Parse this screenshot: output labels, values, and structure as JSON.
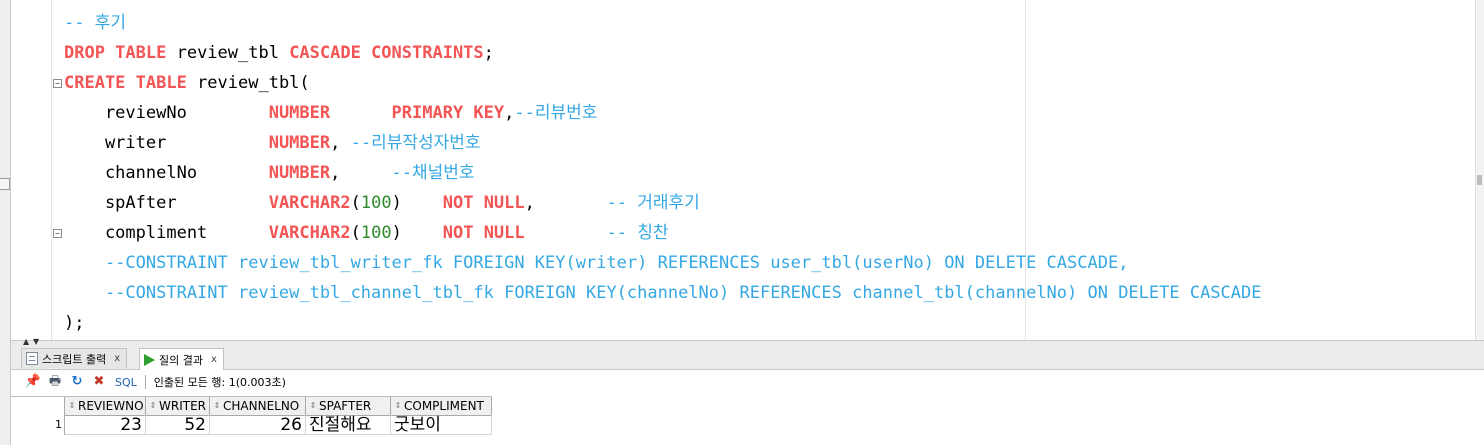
{
  "editor": {
    "lines": [
      [
        {
          "t": "-- 후기",
          "c": "cm"
        }
      ],
      [
        {
          "t": "DROP TABLE",
          "c": "kw"
        },
        {
          "t": " review_tbl ",
          "c": ""
        },
        {
          "t": "CASCADE CONSTRAINTS",
          "c": "kw"
        },
        {
          "t": ";",
          "c": ""
        }
      ],
      [
        {
          "t": "CREATE TABLE",
          "c": "kw"
        },
        {
          "t": " review_tbl(",
          "c": ""
        }
      ],
      [
        {
          "t": "    reviewNo        ",
          "c": ""
        },
        {
          "t": "NUMBER",
          "c": "kw"
        },
        {
          "t": "      ",
          "c": ""
        },
        {
          "t": "PRIMARY KEY",
          "c": "kw"
        },
        {
          "t": ",",
          "c": ""
        },
        {
          "t": "--리뷰번호",
          "c": "cm"
        }
      ],
      [
        {
          "t": "    writer          ",
          "c": ""
        },
        {
          "t": "NUMBER",
          "c": "kw"
        },
        {
          "t": ", ",
          "c": ""
        },
        {
          "t": "--리뷰작성자번호",
          "c": "cm"
        }
      ],
      [
        {
          "t": "    channelNo       ",
          "c": ""
        },
        {
          "t": "NUMBER",
          "c": "kw"
        },
        {
          "t": ",     ",
          "c": ""
        },
        {
          "t": "--채널번호",
          "c": "cm"
        }
      ],
      [
        {
          "t": "    spAfter         ",
          "c": ""
        },
        {
          "t": "VARCHAR2",
          "c": "kw"
        },
        {
          "t": "(",
          "c": ""
        },
        {
          "t": "100",
          "c": "num"
        },
        {
          "t": ")    ",
          "c": ""
        },
        {
          "t": "NOT NULL",
          "c": "kw"
        },
        {
          "t": ",       ",
          "c": ""
        },
        {
          "t": "-- 거래후기",
          "c": "cm"
        }
      ],
      [
        {
          "t": "    compliment      ",
          "c": ""
        },
        {
          "t": "VARCHAR2",
          "c": "kw"
        },
        {
          "t": "(",
          "c": ""
        },
        {
          "t": "100",
          "c": "num"
        },
        {
          "t": ")    ",
          "c": ""
        },
        {
          "t": "NOT NULL",
          "c": "kw"
        },
        {
          "t": "        ",
          "c": ""
        },
        {
          "t": "-- 칭찬",
          "c": "cm"
        }
      ],
      [
        {
          "t": "    --CONSTRAINT review_tbl_writer_fk FOREIGN KEY(writer) REFERENCES user_tbl(userNo) ON DELETE CASCADE,",
          "c": "cm"
        }
      ],
      [
        {
          "t": "    --CONSTRAINT review_tbl_channel_tbl_fk FOREIGN KEY(channelNo) REFERENCES channel_tbl(channelNo) ON DELETE CASCADE",
          "c": "cm"
        }
      ],
      [
        {
          "t": ");",
          "c": ""
        }
      ]
    ]
  },
  "tabs": [
    {
      "label": "스크립트 출력",
      "close": "x",
      "icon": "script-output-icon"
    },
    {
      "label": "질의 결과",
      "close": "x",
      "icon": "run-query-icon"
    }
  ],
  "toolbar": {
    "pin_icon": "📌",
    "print_icon": "🖶",
    "refresh_icon": "↻",
    "export_icon": "✖",
    "sql_label": "SQL",
    "fetch_status": "인출된 모든 행: 1(0.003초)"
  },
  "grid": {
    "columns": [
      "REVIEWNO",
      "WRITER",
      "CHANNELNO",
      "SPAFTER",
      "COMPLIMENT"
    ],
    "sort_glyph": "⇕",
    "rows": [
      {
        "rownum": "1",
        "cells": [
          "23",
          "52",
          "26",
          "진절해요",
          "굿보이"
        ]
      }
    ]
  },
  "colors": {
    "keyword": "#f35454",
    "comment": "#35a8e4",
    "number": "#2f8a2f"
  }
}
